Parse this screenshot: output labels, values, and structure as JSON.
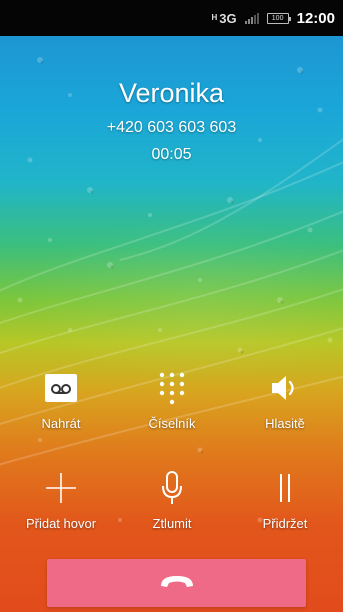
{
  "status_bar": {
    "network_type": "3G",
    "network_sub": "H",
    "battery_level": "100",
    "time": "12:00"
  },
  "call": {
    "contact_name": "Veronika",
    "phone_number": "+420 603 603 603",
    "duration": "00:05"
  },
  "actions": [
    {
      "label": "Nahrát",
      "icon": "record-icon"
    },
    {
      "label": "Číselník",
      "icon": "dialpad-icon"
    },
    {
      "label": "Hlasitě",
      "icon": "speaker-icon"
    },
    {
      "label": "Přidat hovor",
      "icon": "add-call-icon"
    },
    {
      "label": "Ztlumit",
      "icon": "microphone-icon"
    },
    {
      "label": "Přidržet",
      "icon": "pause-icon"
    }
  ],
  "end_call": {
    "icon": "hang-up-icon",
    "color": "#ee6a86"
  },
  "colors": {
    "statusbar_bg": "#050505",
    "background_top": "#1f8fd0",
    "background_bottom": "#e24b1c"
  }
}
